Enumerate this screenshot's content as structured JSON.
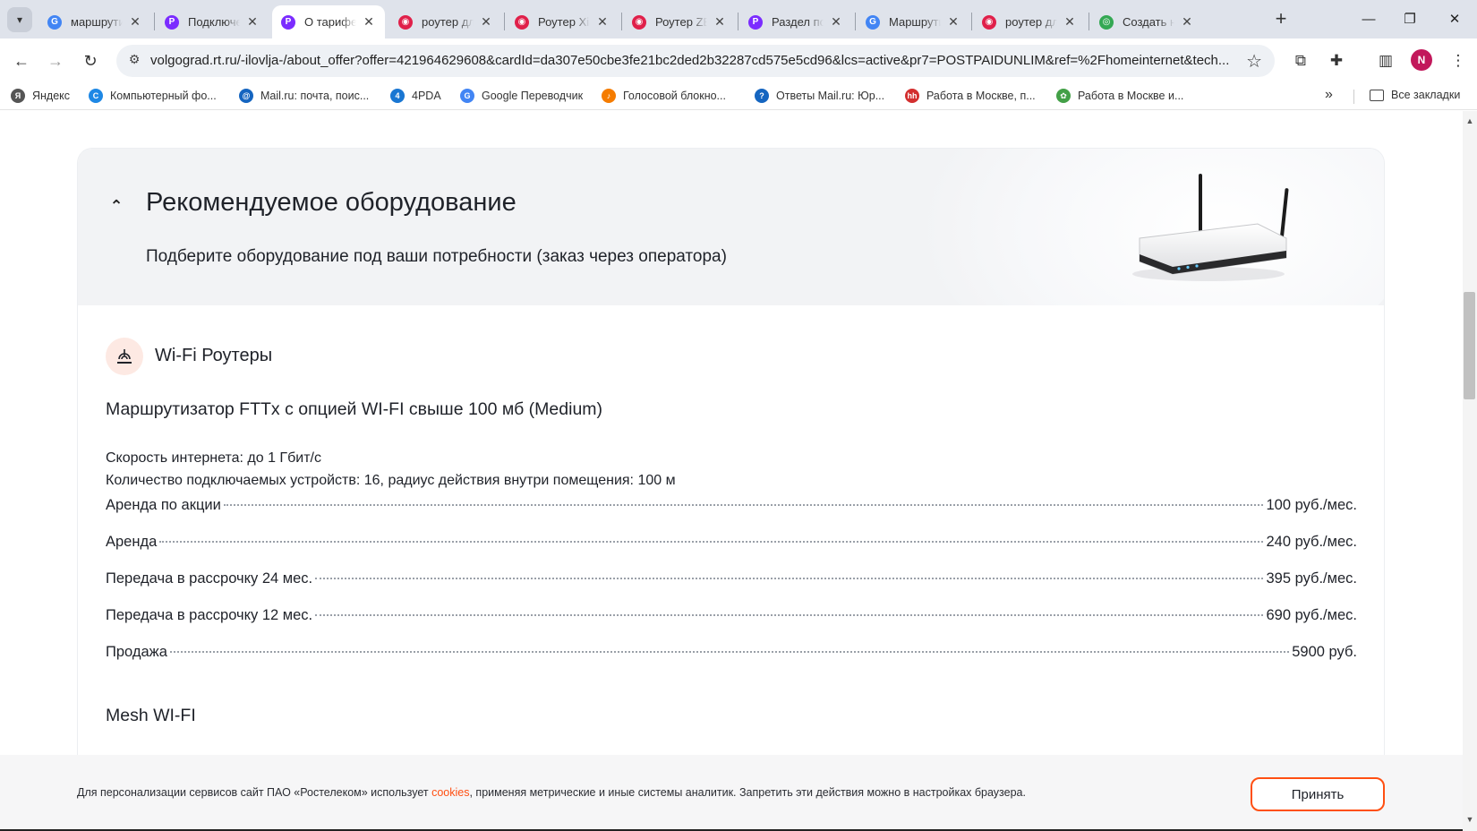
{
  "browser": {
    "tabs": [
      {
        "title": "маршрутизатор",
        "favicon": "google-icon",
        "fav_color": "#4285f4",
        "fav_glyph": "G",
        "active": false
      },
      {
        "title": "Подключение",
        "favicon": "rostelecom-icon",
        "fav_color": "#7b2cff",
        "fav_glyph": "P",
        "active": false
      },
      {
        "title": "О тарифе",
        "favicon": "rostelecom-icon",
        "fav_color": "#7b2cff",
        "fav_glyph": "P",
        "active": true
      },
      {
        "title": "роутер для",
        "favicon": "dns-icon",
        "fav_color": "#e0204a",
        "fav_glyph": "◉",
        "active": false
      },
      {
        "title": "Роутер Xiaomi",
        "favicon": "dns-icon",
        "fav_color": "#e0204a",
        "fav_glyph": "◉",
        "active": false
      },
      {
        "title": "Роутер ZBT",
        "favicon": "dns-icon",
        "fav_color": "#e0204a",
        "fav_glyph": "◉",
        "active": false
      },
      {
        "title": "Раздел по",
        "favicon": "rostelecom-icon",
        "fav_color": "#7b2cff",
        "fav_glyph": "P",
        "active": false
      },
      {
        "title": "Маршрутизатор",
        "favicon": "google-icon",
        "fav_color": "#4285f4",
        "fav_glyph": "G",
        "active": false
      },
      {
        "title": "роутер для",
        "favicon": "dns-icon",
        "fav_color": "#e0204a",
        "fav_glyph": "◉",
        "active": false
      },
      {
        "title": "Создать новое",
        "favicon": "google-docs-icon",
        "fav_color": "#34a853",
        "fav_glyph": "◎",
        "active": false
      }
    ],
    "url": "volgograd.rt.ru/-ilovlja-/about_offer?offer=421964629608&cardId=da307e50cbe3fe21bc2ded2b32287cd575e5cd96&lcs=active&pr7=POSTPAIDUNLIM&ref=%2Fhomeinternet&tech...",
    "avatar_letter": "N",
    "bookmarks": [
      {
        "label": "Яндекс",
        "icon": "yandex-icon",
        "color": "#555555",
        "glyph": "Я"
      },
      {
        "label": "Компьютерный фо...",
        "icon": "forum-icon",
        "color": "#1e88e5",
        "glyph": "C"
      },
      {
        "label": "Mail.ru: почта, поис...",
        "icon": "mailru-icon",
        "color": "#1565c0",
        "glyph": "@"
      },
      {
        "label": "4PDA",
        "icon": "4pda-icon",
        "color": "#1976d2",
        "glyph": "4"
      },
      {
        "label": "Google Переводчик",
        "icon": "google-translate-icon",
        "color": "#4285f4",
        "glyph": "G"
      },
      {
        "label": "Голосовой блокно...",
        "icon": "voice-notepad-icon",
        "color": "#f57c00",
        "glyph": "♪"
      },
      {
        "label": "Ответы Mail.ru: Юр...",
        "icon": "answers-icon",
        "color": "#1565c0",
        "glyph": "?"
      },
      {
        "label": "Работа в Москве, п...",
        "icon": "hh-icon",
        "color": "#d32f2f",
        "glyph": "hh"
      },
      {
        "label": "Работа в Москве и...",
        "icon": "jobs-icon",
        "color": "#43a047",
        "glyph": "✿"
      }
    ],
    "all_bookmarks_label": "Все закладки"
  },
  "page": {
    "section_heading": "Рекомендуемое оборудование",
    "section_subheading": "Подберите оборудование под ваши потребности (заказ через оператора)",
    "category_title": "Wi-Fi Роутеры",
    "product_title": "Маршрутизатор FTTx с опцией WI-FI свыше 100 мб (Medium)",
    "specs": [
      "Скорость интернета: до 1 Гбит/с",
      "Количество подключаемых устройств: 16, радиус действия внутри помещения: 100 м"
    ],
    "prices": [
      {
        "label": "Аренда по акции",
        "value": "100 руб./мес."
      },
      {
        "label": "Аренда",
        "value": "240 руб./мес."
      },
      {
        "label": "Передача в рассрочку 24 мес.",
        "value": "395 руб./мес."
      },
      {
        "label": "Передача в рассрочку 12 мес.",
        "value": "690 руб./мес."
      },
      {
        "label": "Продажа",
        "value": "5900 руб."
      }
    ],
    "next_product_title": "Mesh WI-FI"
  },
  "cookie_banner": {
    "text_before": "Для персонализации сервисов сайт ПАО «Ростелеком» использует ",
    "link": "cookies",
    "text_after": ", применяя метрические и иные системы аналитик. Запретить эти действия можно в настройках браузера.",
    "accept_label": "Принять"
  },
  "colors": {
    "accent": "#ff4f12",
    "icon_bg": "#fde9e3",
    "header_bg": "#f2f3f5"
  }
}
